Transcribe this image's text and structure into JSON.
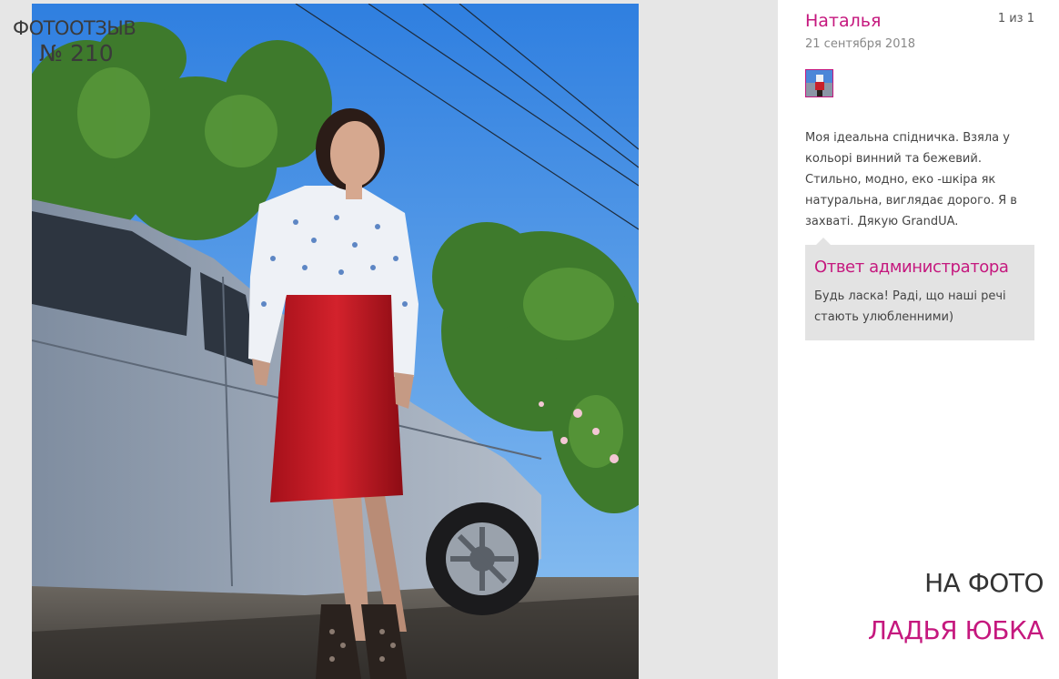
{
  "review_number": {
    "label": "ФОТООТЗЫВ",
    "number": "№ 210"
  },
  "photo": {
    "description_icon": "review-photo"
  },
  "panel": {
    "author": "Наталья",
    "counter": "1 из 1",
    "date": "21 сентября 2018",
    "review_text": "Моя ідеальна спідничка. Взяла у кольорі винний та бежевий. Стильно, модно, еко -шкіра як натуральна, виглядає дорого. Я в захваті. Дякую GrandUA.",
    "admin": {
      "title": "Ответ администратора",
      "text": "Будь ласка! Раді, що наші речі стають улюбленними)"
    },
    "on_photo_label": "НА ФОТО",
    "product_name": "ЛАДЬЯ ЮБКА"
  },
  "colors": {
    "accent": "#c5187e",
    "panel_bg": "#ffffff",
    "page_bg": "#e6e6e6",
    "admin_bg": "#e3e3e3"
  }
}
